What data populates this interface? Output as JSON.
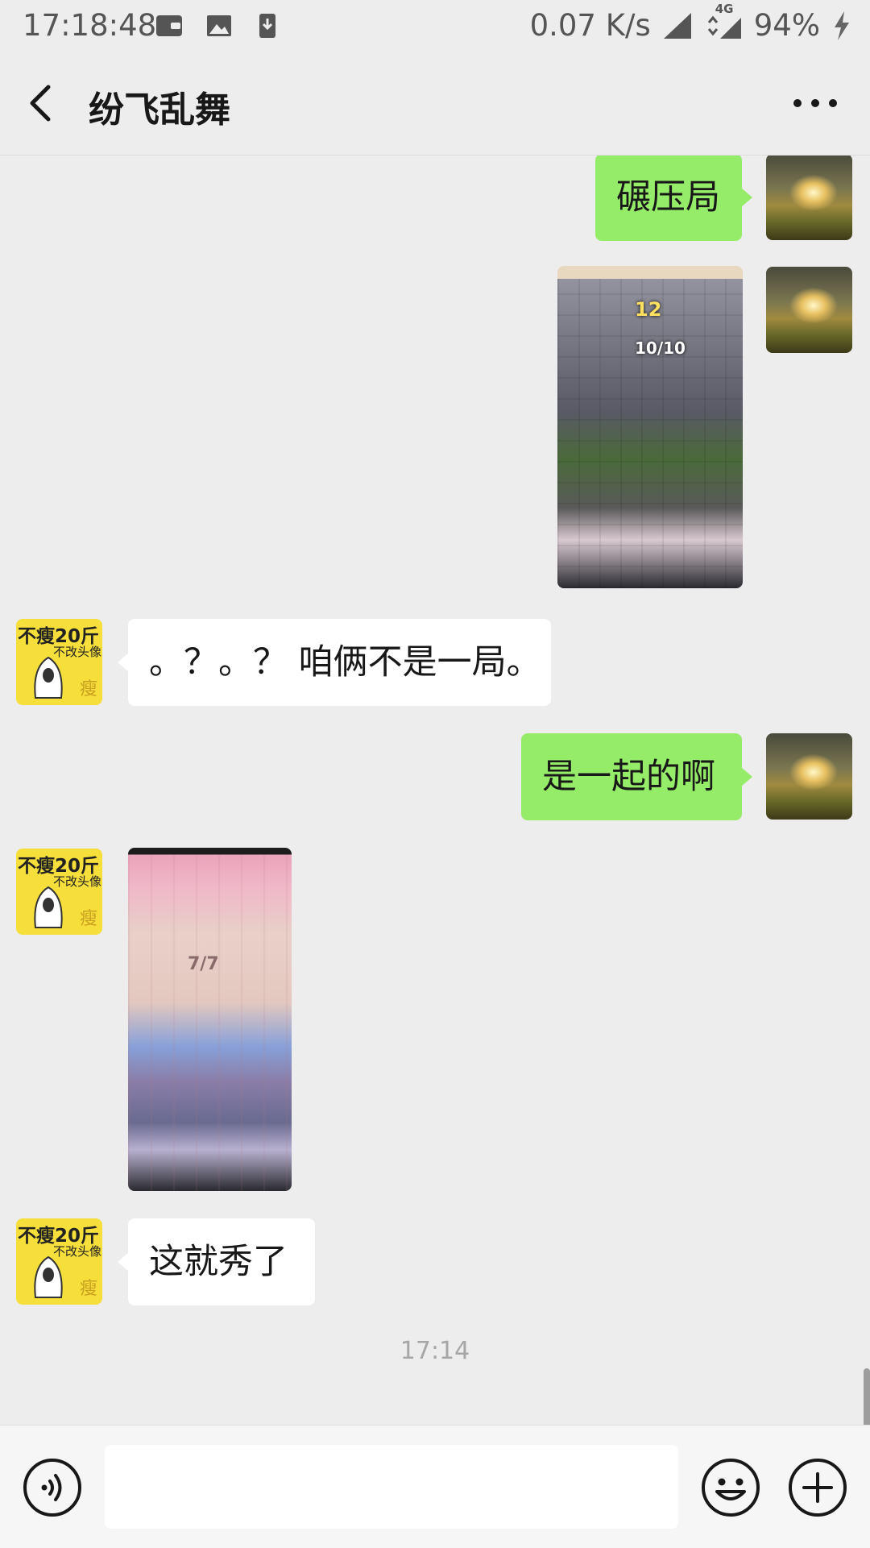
{
  "status_bar": {
    "time": "17:18:48",
    "net_speed": "0.07 K/s",
    "network": "4G",
    "battery": "94%"
  },
  "header": {
    "title": "纷飞乱舞"
  },
  "avatar_other": {
    "line1": "不瘦20斤",
    "line2": "不改头像",
    "glyphs": "瘦"
  },
  "messages": {
    "m1": "碾压局",
    "m3": "。？。？ 咱俩不是一局。",
    "m4": "是一起的啊",
    "m6": "这就秀了"
  },
  "screenshot1": {
    "round": "12",
    "units": "10/10"
  },
  "screenshot2": {
    "units": "7/7"
  },
  "timestamp": "17:14",
  "input": {
    "value": ""
  },
  "icons": {
    "back": "back-arrow-icon",
    "more": "more-icon",
    "voice": "voice-icon",
    "emoji": "emoji-icon",
    "plus": "plus-icon"
  }
}
